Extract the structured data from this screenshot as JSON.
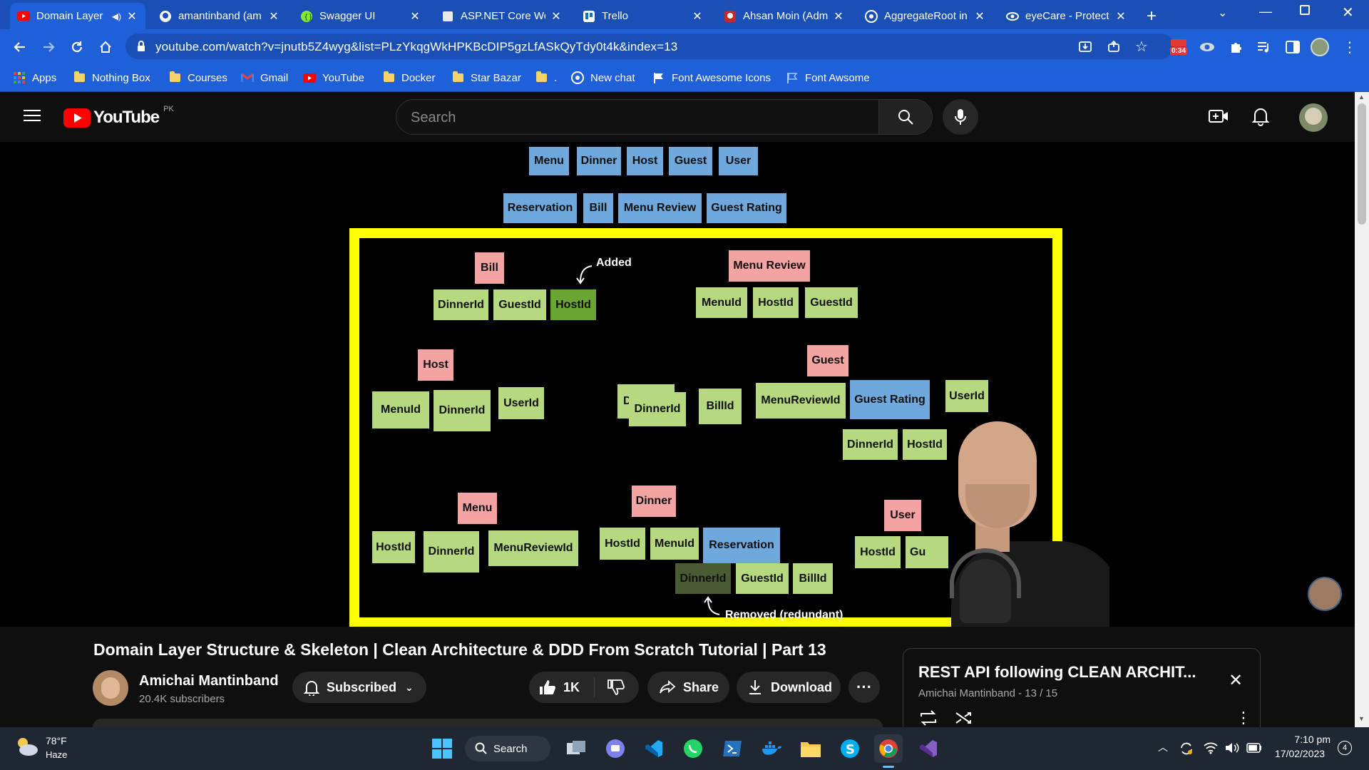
{
  "browser": {
    "tabs": [
      {
        "label": "Domain Layer",
        "active": true
      },
      {
        "label": "amantinband (am"
      },
      {
        "label": "Swagger UI"
      },
      {
        "label": "ASP.NET Core We"
      },
      {
        "label": "Trello"
      },
      {
        "label": "Ahsan Moin (Adm"
      },
      {
        "label": "AggregateRoot in"
      },
      {
        "label": "eyeCare - Protect"
      }
    ],
    "url": "youtube.com/watch?v=jnutb5Z4wyg&list=PLzYkqgWkHPKBcDIP5gzLfASkQyTdy0t4k&index=13",
    "timer_badge": "0:34",
    "bookmarks": [
      "Apps",
      "Nothing Box",
      "Courses",
      "Gmail",
      "YouTube",
      "Docker",
      "Star Bazar",
      ".",
      "New chat",
      "Font Awesome Icons",
      "Font Awsome"
    ]
  },
  "youtube": {
    "logo_text": "YouTube",
    "region": "PK",
    "search_placeholder": "Search"
  },
  "video_content": {
    "top_row1": [
      "Menu",
      "Dinner",
      "Host",
      "Guest",
      "User"
    ],
    "top_row2": [
      "Reservation",
      "Bill",
      "Menu Review",
      "Guest Rating"
    ],
    "notes": {
      "bill": "Bill",
      "bill_dinner": "DinnerId",
      "bill_guest": "GuestId",
      "bill_host": "HostId",
      "added": "Added",
      "menureview": "Menu Review",
      "mr_menu": "MenuId",
      "mr_host": "HostId",
      "mr_guest": "GuestId",
      "host": "Host",
      "host_menu": "MenuId",
      "host_dinner": "DinnerId",
      "host_user": "UserId",
      "guest": "Guest",
      "g_d": "D",
      "g_dinner": "DinnerId",
      "g_bill": "BillId",
      "g_menureview": "MenuReviewId",
      "g_rating": "Guest Rating",
      "g_user": "UserId",
      "g_dinner2": "DinnerId",
      "g_host": "HostId",
      "menu": "Menu",
      "m_host": "HostId",
      "m_dinner": "DinnerId",
      "m_menureview": "MenuReviewId",
      "dinner": "Dinner",
      "d_host": "HostId",
      "d_menu": "MenuId",
      "d_reservation": "Reservation",
      "d_dinner": "DinnerId",
      "d_guest": "GuestId",
      "d_bill": "BillId",
      "removed": "Removed (redundant)",
      "user": "User",
      "u_host": "HostId",
      "u_gu": "Gu"
    }
  },
  "video": {
    "title": "Domain Layer Structure & Skeleton | Clean Architecture & DDD From Scratch Tutorial | Part 13",
    "channel": "Amichai Mantinband",
    "subscribers": "20.4K subscribers",
    "subscribed_label": "Subscribed",
    "likes": "1K",
    "share_label": "Share",
    "download_label": "Download"
  },
  "playlist": {
    "title": "REST API following CLEAN ARCHIT...",
    "subtitle": "Amichai Mantinband - 13 / 15"
  },
  "taskbar": {
    "weather_temp": "78°F",
    "weather_desc": "Haze",
    "search_label": "Search",
    "time": "7:10 pm",
    "date": "17/02/2023",
    "notification_count": "4"
  }
}
